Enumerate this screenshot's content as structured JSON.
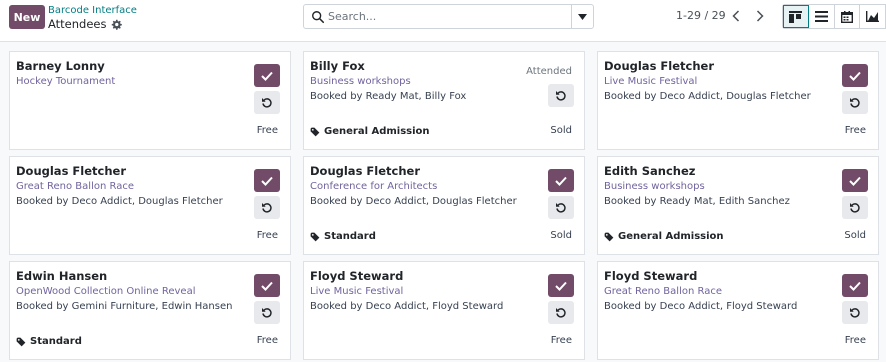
{
  "header": {
    "new_label": "New",
    "breadcrumb": "Barcode Interface",
    "title": "Attendees",
    "search_placeholder": "Search...",
    "pager": "1-29 / 29"
  },
  "colors": {
    "primary": "#714b67",
    "link": "#017e84",
    "event": "#71639e"
  },
  "cards": [
    {
      "name": "Barney Lonny",
      "event": "Hockey Tournament",
      "booked": "",
      "ticket": "",
      "price": "Free",
      "status": ""
    },
    {
      "name": "Billy Fox",
      "event": "Business workshops",
      "booked": "Booked by Ready Mat, Billy Fox",
      "ticket": "General Admission",
      "price": "Sold",
      "status": "Attended"
    },
    {
      "name": "Douglas Fletcher",
      "event": "Live Music Festival",
      "booked": "Booked by Deco Addict, Douglas Fletcher",
      "ticket": "",
      "price": "Free",
      "status": ""
    },
    {
      "name": "Douglas Fletcher",
      "event": "Great Reno Ballon Race",
      "booked": "Booked by Deco Addict, Douglas Fletcher",
      "ticket": "",
      "price": "Free",
      "status": ""
    },
    {
      "name": "Douglas Fletcher",
      "event": "Conference for Architects",
      "booked": "Booked by Deco Addict, Douglas Fletcher",
      "ticket": "Standard",
      "price": "Sold",
      "status": ""
    },
    {
      "name": "Edith Sanchez",
      "event": "Business workshops",
      "booked": "Booked by Ready Mat, Edith Sanchez",
      "ticket": "General Admission",
      "price": "Sold",
      "status": ""
    },
    {
      "name": "Edwin Hansen",
      "event": "OpenWood Collection Online Reveal",
      "booked": "Booked by Gemini Furniture, Edwin Hansen",
      "ticket": "Standard",
      "price": "Free",
      "status": ""
    },
    {
      "name": "Floyd Steward",
      "event": "Live Music Festival",
      "booked": "Booked by Deco Addict, Floyd Steward",
      "ticket": "",
      "price": "Free",
      "status": ""
    },
    {
      "name": "Floyd Steward",
      "event": "Great Reno Ballon Race",
      "booked": "Booked by Deco Addict, Floyd Steward",
      "ticket": "",
      "price": "Free",
      "status": ""
    }
  ]
}
